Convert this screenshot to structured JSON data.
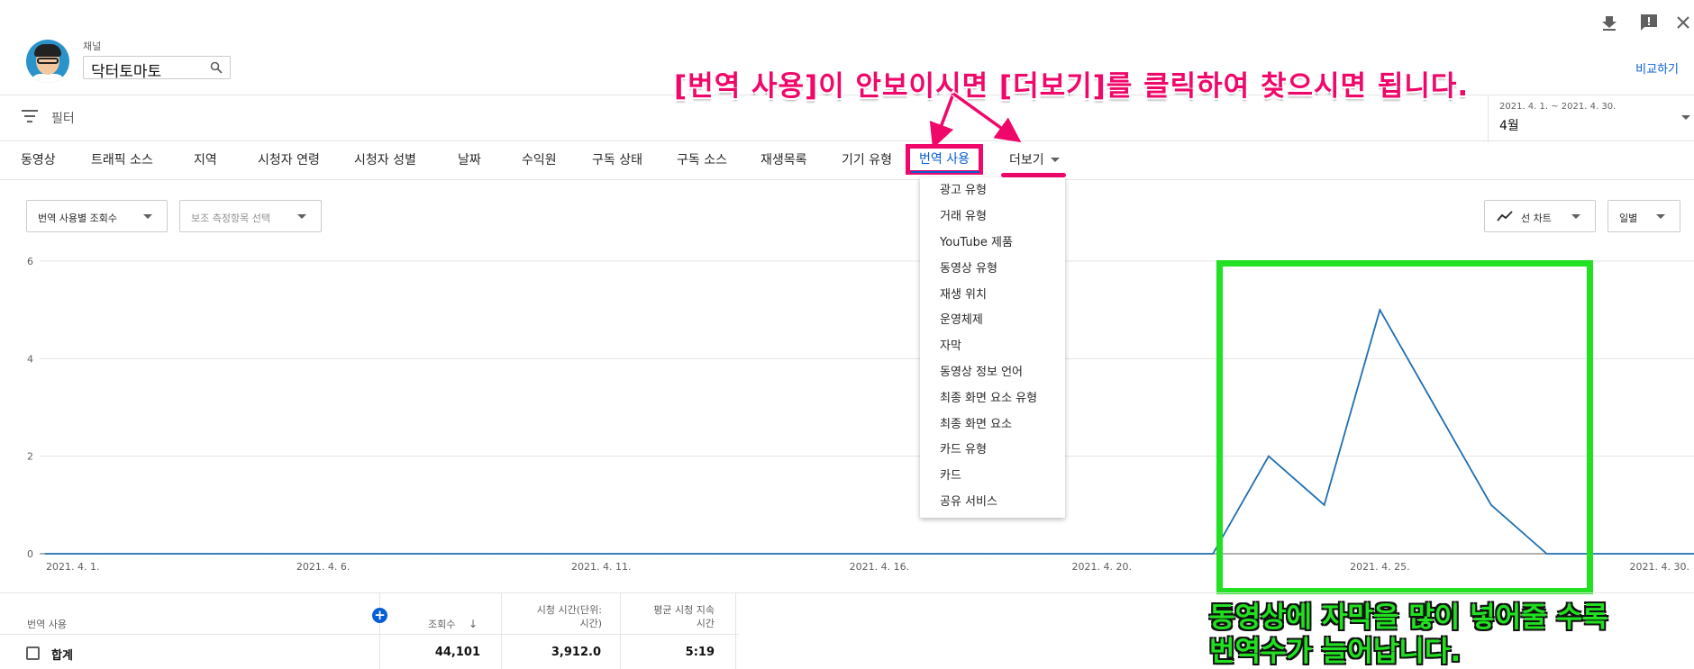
{
  "header": {
    "channel_label": "채널",
    "channel_name": "닥터토마토",
    "compare_link": "비교하기",
    "icons": [
      "download-icon",
      "feedback-icon",
      "close-icon"
    ]
  },
  "filter": {
    "label": "필터",
    "date_range": "2021. 4. 1. ~ 2021. 4. 30.",
    "date_month": "4월"
  },
  "tabs": [
    {
      "label": "동영상"
    },
    {
      "label": "트래픽 소스"
    },
    {
      "label": "지역"
    },
    {
      "label": "시청자 연령"
    },
    {
      "label": "시청자 성별"
    },
    {
      "label": "날짜"
    },
    {
      "label": "수익원"
    },
    {
      "label": "구독 상태"
    },
    {
      "label": "구독 소스"
    },
    {
      "label": "재생목록"
    },
    {
      "label": "기기 유형"
    },
    {
      "label": "번역 사용"
    },
    {
      "label": "더보기"
    }
  ],
  "more_menu": [
    "광고 유형",
    "거래 유형",
    "YouTube 제품",
    "동영상 유형",
    "재생 위치",
    "운영체제",
    "자막",
    "동영상 정보 언어",
    "최종 화면 요소 유형",
    "최종 화면 요소",
    "카드 유형",
    "카드",
    "공유 서비스"
  ],
  "selectors": {
    "metric": "번역 사용별 조회수",
    "secondary": "보조 측정항목 선택",
    "chart_type": "선 차트",
    "period": "일별"
  },
  "annotations": {
    "top": "[번역 사용]이 안보이시면 [더보기]를 클릭하여 찾으시면 됩니다.",
    "bottom_line1": "동영상에 자막을 많이 넣어줄 수록",
    "bottom_line2": "번역수가 늘어납니다."
  },
  "colors": {
    "accent_blue": "#065fd4",
    "annotation_pink": "#f0076a",
    "annotation_green": "#22e022",
    "line": "#1f6fb2"
  },
  "chart_data": {
    "type": "line",
    "y_ticks": [
      "0",
      "2",
      "4",
      "6"
    ],
    "ylim": [
      0,
      6
    ],
    "x_tick_labels": [
      {
        "day": 1,
        "label": "2021. 4. 1."
      },
      {
        "day": 6,
        "label": "2021. 4. 6."
      },
      {
        "day": 11,
        "label": "2021. 4. 11."
      },
      {
        "day": 16,
        "label": "2021. 4. 16."
      },
      {
        "day": 20,
        "label": "2021. 4. 20."
      },
      {
        "day": 25,
        "label": "2021. 4. 25."
      },
      {
        "day": 30,
        "label": "2021. 4. 30."
      }
    ],
    "x": [
      1,
      2,
      3,
      4,
      5,
      6,
      7,
      8,
      9,
      10,
      11,
      12,
      13,
      14,
      15,
      16,
      17,
      18,
      19,
      20,
      21,
      22,
      23,
      24,
      25,
      26,
      27,
      28,
      29,
      30
    ],
    "values": [
      0,
      0,
      0,
      0,
      0,
      0,
      0,
      0,
      0,
      0,
      0,
      0,
      0,
      0,
      0,
      0,
      0,
      0,
      0,
      0,
      0,
      0,
      2,
      1,
      5,
      3,
      1,
      0,
      0,
      0
    ]
  },
  "table": {
    "headers": {
      "dimension": "번역 사용",
      "views": "조회수",
      "watch_time_1": "시청 시간(단위:",
      "watch_time_2": "시간)",
      "avg_duration_1": "평균 시청 지속",
      "avg_duration_2": "시간"
    },
    "total_row": {
      "label": "합계",
      "views": "44,101",
      "watch_time": "3,912.0",
      "avg_duration": "5:19"
    }
  }
}
